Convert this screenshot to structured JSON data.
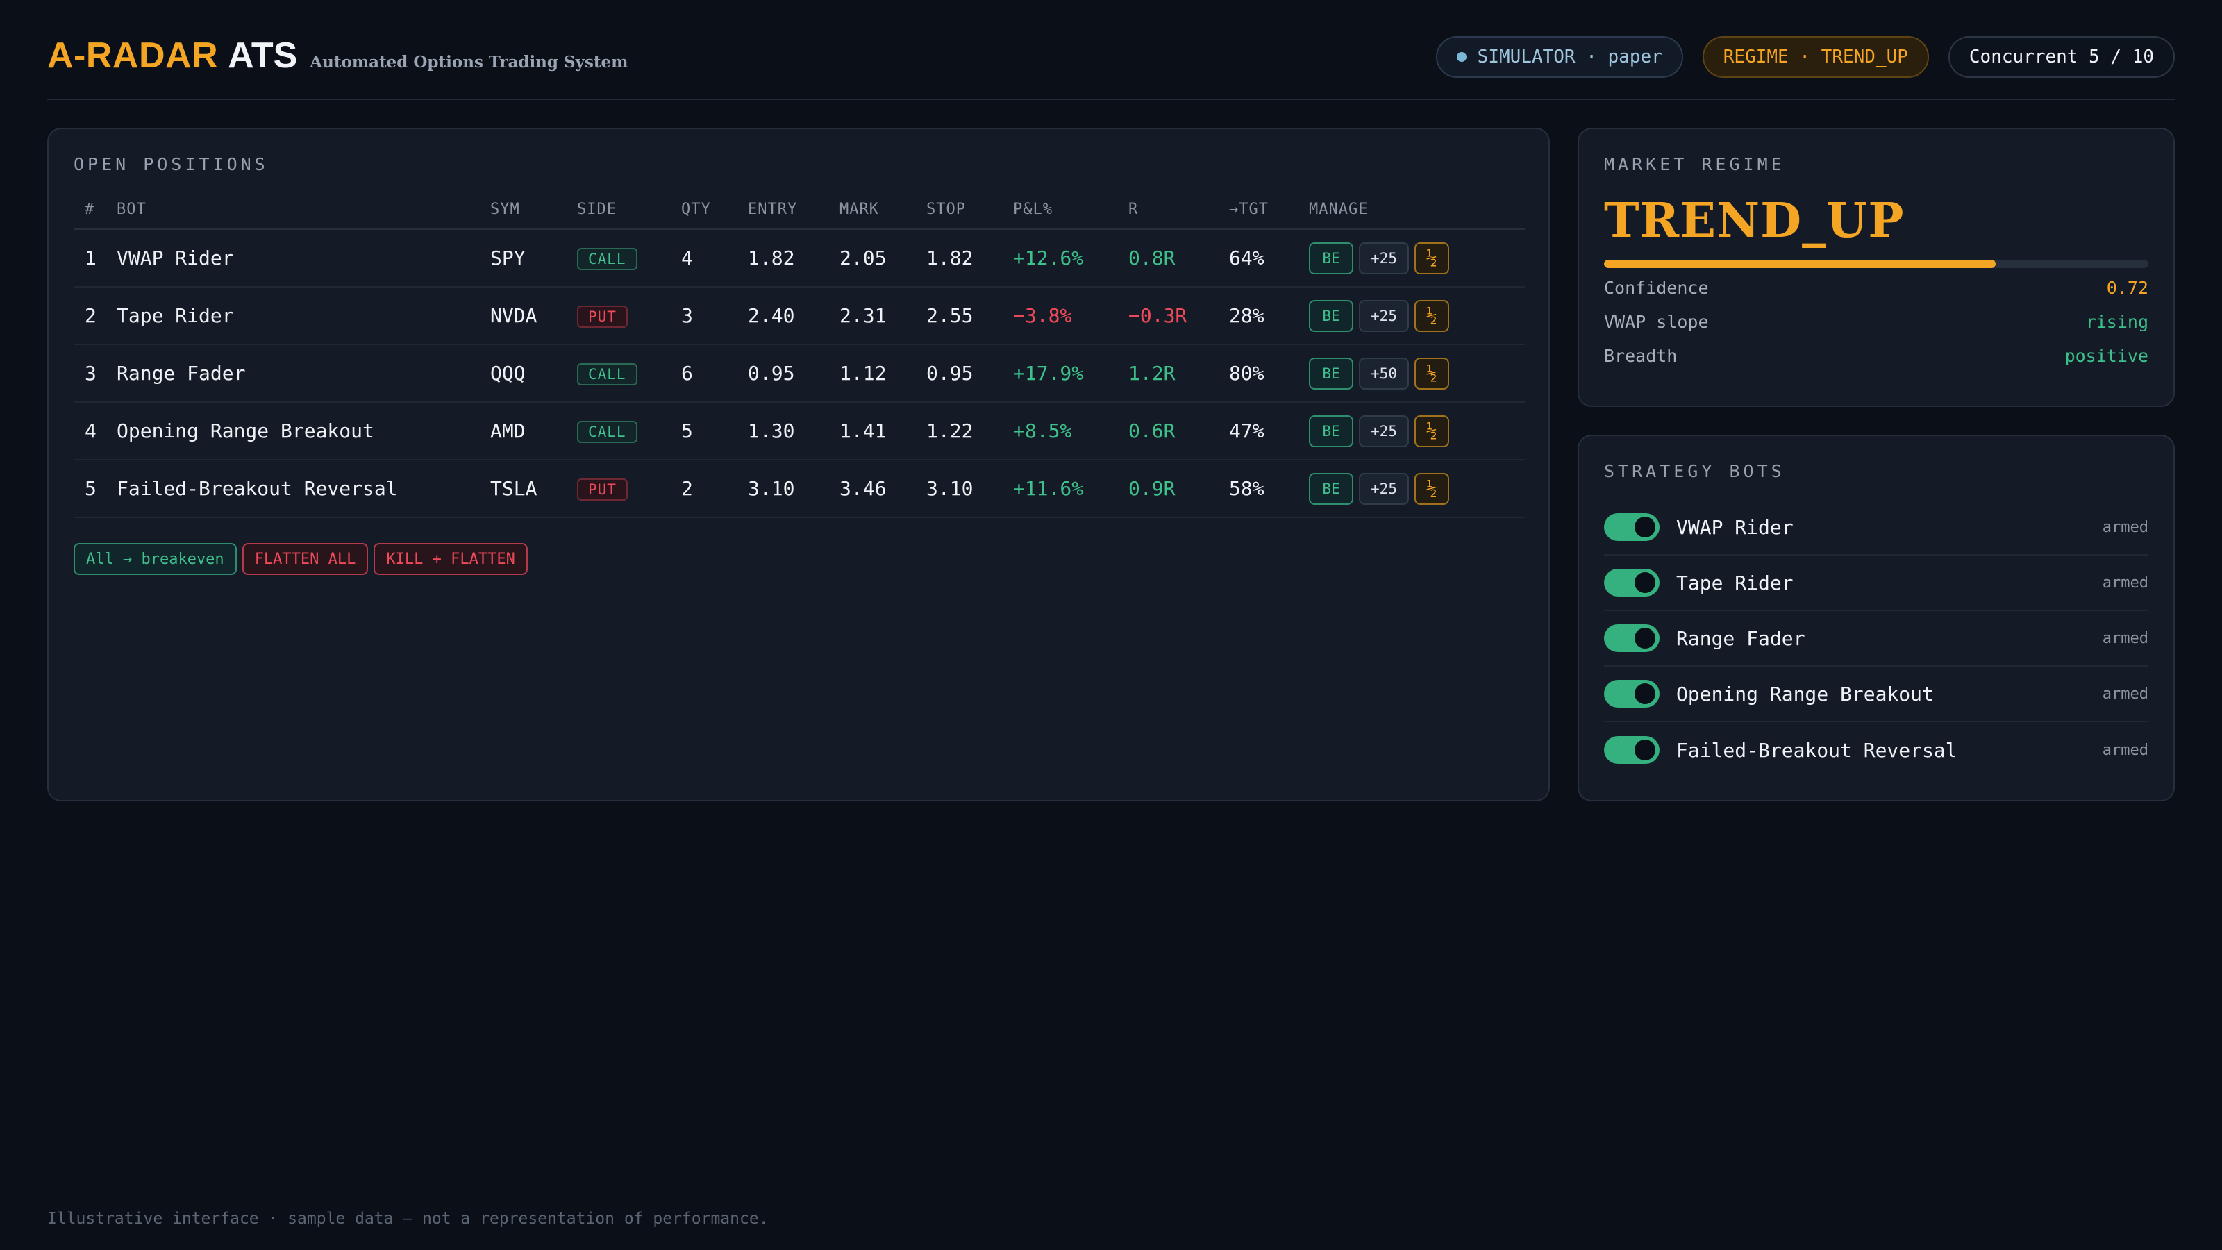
{
  "brand": {
    "name_a": "A-RADAR",
    "name_b": "ATS",
    "subtitle": "Automated Options Trading System"
  },
  "status": {
    "simulator": "SIMULATOR · paper",
    "regime": "REGIME · TREND_UP",
    "concurrent": "Concurrent 5 / 10"
  },
  "positions": {
    "title": "OPEN POSITIONS",
    "columns": [
      "#",
      "BOT",
      "SYM",
      "SIDE",
      "QTY",
      "ENTRY",
      "MARK",
      "STOP",
      "P&L%",
      "R",
      "→TGT",
      "MANAGE"
    ],
    "rows": [
      {
        "n": "1",
        "bot": "VWAP Rider",
        "sym": "SPY",
        "side": "CALL",
        "qty": "4",
        "entry": "1.82",
        "mark": "2.05",
        "stop": "1.82",
        "pnl": "+12.6%",
        "r": "0.8R",
        "tgt": "64%",
        "be": "BE",
        "plus": "+25",
        "half": "½"
      },
      {
        "n": "2",
        "bot": "Tape Rider",
        "sym": "NVDA",
        "side": "PUT",
        "qty": "3",
        "entry": "2.40",
        "mark": "2.31",
        "stop": "2.55",
        "pnl": "−3.8%",
        "r": "−0.3R",
        "tgt": "28%",
        "be": "BE",
        "plus": "+25",
        "half": "½"
      },
      {
        "n": "3",
        "bot": "Range Fader",
        "sym": "QQQ",
        "side": "CALL",
        "qty": "6",
        "entry": "0.95",
        "mark": "1.12",
        "stop": "0.95",
        "pnl": "+17.9%",
        "r": "1.2R",
        "tgt": "80%",
        "be": "BE",
        "plus": "+50",
        "half": "½"
      },
      {
        "n": "4",
        "bot": "Opening Range Breakout",
        "sym": "AMD",
        "side": "CALL",
        "qty": "5",
        "entry": "1.30",
        "mark": "1.41",
        "stop": "1.22",
        "pnl": "+8.5%",
        "r": "0.6R",
        "tgt": "47%",
        "be": "BE",
        "plus": "+25",
        "half": "½"
      },
      {
        "n": "5",
        "bot": "Failed-Breakout Reversal",
        "sym": "TSLA",
        "side": "PUT",
        "qty": "2",
        "entry": "3.10",
        "mark": "3.46",
        "stop": "3.10",
        "pnl": "+11.6%",
        "r": "0.9R",
        "tgt": "58%",
        "be": "BE",
        "plus": "+25",
        "half": "½"
      }
    ],
    "actions": {
      "all_breakeven": "All → breakeven",
      "flatten_all": "FLATTEN ALL",
      "kill_flatten": "KILL + FLATTEN"
    }
  },
  "regime": {
    "title": "MARKET REGIME",
    "value": "TREND_UP",
    "confidence_fraction": 0.72,
    "stats": [
      {
        "label": "Confidence",
        "value": "0.72",
        "color": "#f5a524"
      },
      {
        "label": "VWAP slope",
        "value": "rising",
        "color": "#3ec08a"
      },
      {
        "label": "Breadth",
        "value": "positive",
        "color": "#3ec08a"
      }
    ]
  },
  "bots": {
    "title": "STRATEGY BOTS",
    "items": [
      {
        "name": "VWAP Rider",
        "status": "armed",
        "on": true
      },
      {
        "name": "Tape Rider",
        "status": "armed",
        "on": true
      },
      {
        "name": "Range Fader",
        "status": "armed",
        "on": true
      },
      {
        "name": "Opening Range Breakout",
        "status": "armed",
        "on": true
      },
      {
        "name": "Failed-Breakout Reversal",
        "status": "armed",
        "on": true
      }
    ]
  },
  "footer": "Illustrative interface · sample data — not a representation of performance.",
  "colors": {
    "accent": "#f5a524",
    "positive": "#3ec08a",
    "negative": "#ef4a5a"
  }
}
